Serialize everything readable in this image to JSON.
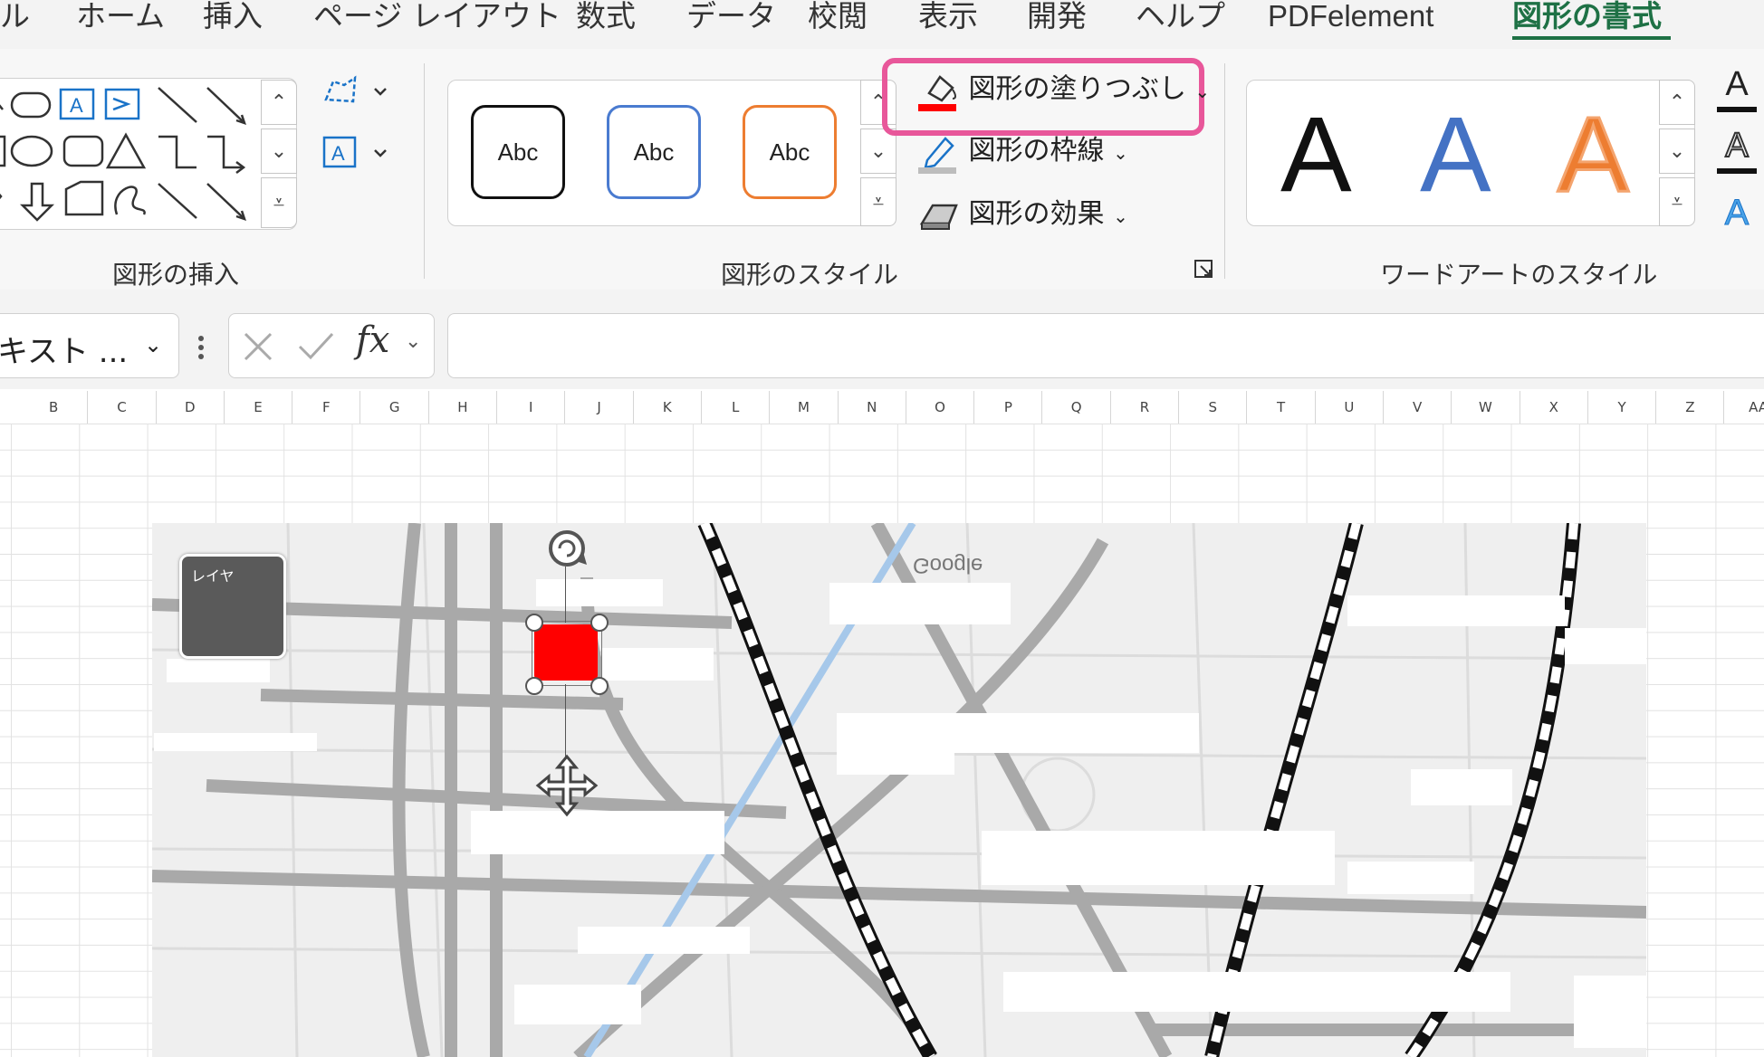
{
  "menu": {
    "tabs": [
      {
        "label": "ル"
      },
      {
        "label": "ホーム"
      },
      {
        "label": "挿入"
      },
      {
        "label": "ページ レイアウト"
      },
      {
        "label": "数式"
      },
      {
        "label": "データ"
      },
      {
        "label": "校閲"
      },
      {
        "label": "表示"
      },
      {
        "label": "開発"
      },
      {
        "label": "ヘルプ"
      },
      {
        "label": "PDFelement"
      },
      {
        "label": "図形の書式"
      }
    ],
    "active_index": 11
  },
  "ribbon": {
    "insert_shapes": {
      "label": "図形の挿入"
    },
    "shape_styles": {
      "label": "図形のスタイル",
      "samples": [
        {
          "text": "Abc",
          "border": "#111111"
        },
        {
          "text": "Abc",
          "border": "#4a7bd0"
        },
        {
          "text": "Abc",
          "border": "#ed7d31"
        }
      ],
      "fill_button": "図形の塗りつぶし",
      "outline_button": "図形の枠線",
      "effects_button": "図形の効果"
    },
    "wordart": {
      "label": "ワードアートのスタイル",
      "letter": "A",
      "colors": [
        "#111111",
        "#4472c4",
        "#ed7d31"
      ]
    },
    "text_fill_letter": "A",
    "highlight_color": "#e8579a",
    "fill_color": "#ff0000"
  },
  "formula_bar": {
    "name_box": "キスト ...",
    "fx": "fx",
    "formula": ""
  },
  "columns": [
    "B",
    "C",
    "D",
    "E",
    "F",
    "G",
    "H",
    "I",
    "J",
    "K",
    "L",
    "M",
    "N",
    "O",
    "P",
    "Q",
    "R",
    "S",
    "T",
    "U",
    "V",
    "W",
    "X",
    "Y",
    "Z",
    "AA"
  ],
  "map": {
    "google_label": "Google",
    "thumb_label": "レイヤ",
    "shape_color": "#ff0000"
  }
}
